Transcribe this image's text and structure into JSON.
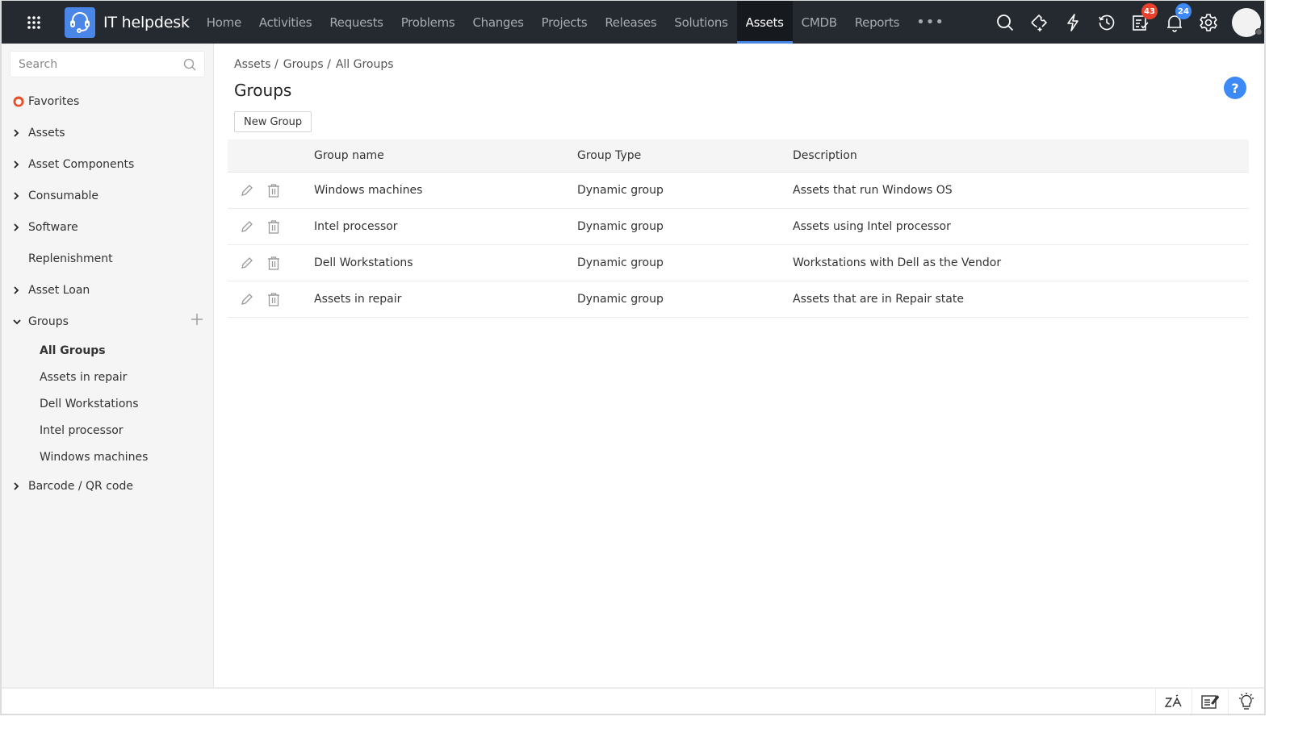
{
  "app": {
    "brand": "IT helpdesk"
  },
  "nav": {
    "items": [
      {
        "label": "Home"
      },
      {
        "label": "Activities"
      },
      {
        "label": "Requests"
      },
      {
        "label": "Problems"
      },
      {
        "label": "Changes"
      },
      {
        "label": "Projects"
      },
      {
        "label": "Releases"
      },
      {
        "label": "Solutions"
      },
      {
        "label": "Assets",
        "active": true
      },
      {
        "label": "CMDB"
      },
      {
        "label": "Reports"
      }
    ],
    "more": "•••"
  },
  "topbar_right": {
    "icons": [
      "search-icon",
      "ticket-add-icon",
      "lightning-icon",
      "history-icon",
      "tasks-icon",
      "bell-icon",
      "gear-icon"
    ],
    "tasks_badge": "43",
    "notifications_badge": "24"
  },
  "sidebar": {
    "search_placeholder": "Search",
    "favorites": "Favorites",
    "items": [
      {
        "label": "Assets",
        "expandable": true
      },
      {
        "label": "Asset Components",
        "expandable": true
      },
      {
        "label": "Consumable",
        "expandable": true
      },
      {
        "label": "Software",
        "expandable": true
      },
      {
        "label": "Replenishment",
        "expandable": false
      },
      {
        "label": "Asset Loan",
        "expandable": true
      }
    ],
    "groups": {
      "label": "Groups",
      "sub": [
        {
          "label": "All Groups",
          "active": true
        },
        {
          "label": "Assets in repair"
        },
        {
          "label": "Dell Workstations"
        },
        {
          "label": "Intel processor"
        },
        {
          "label": "Windows machines"
        }
      ]
    },
    "barcode": "Barcode / QR code"
  },
  "main": {
    "breadcrumb": [
      "Assets /",
      "Groups /",
      "All Groups"
    ],
    "title": "Groups",
    "help": "?",
    "new_button": "New Group",
    "table": {
      "columns": [
        "Group name",
        "Group Type",
        "Description"
      ],
      "rows": [
        {
          "name": "Windows machines",
          "type": "Dynamic group",
          "description": "Assets that run Windows OS"
        },
        {
          "name": "Intel processor",
          "type": "Dynamic group",
          "description": "Assets using Intel processor"
        },
        {
          "name": "Dell Workstations",
          "type": "Dynamic group",
          "description": "Workstations with Dell as the Vendor"
        },
        {
          "name": "Assets in repair",
          "type": "Dynamic group",
          "description": "Assets that are in Repair state"
        }
      ]
    }
  },
  "colors": {
    "topbar": "#252a31",
    "accent": "#4a86e8",
    "badge_red": "#e8412c",
    "badge_blue": "#3d8af7",
    "favorite": "#e8502c"
  }
}
